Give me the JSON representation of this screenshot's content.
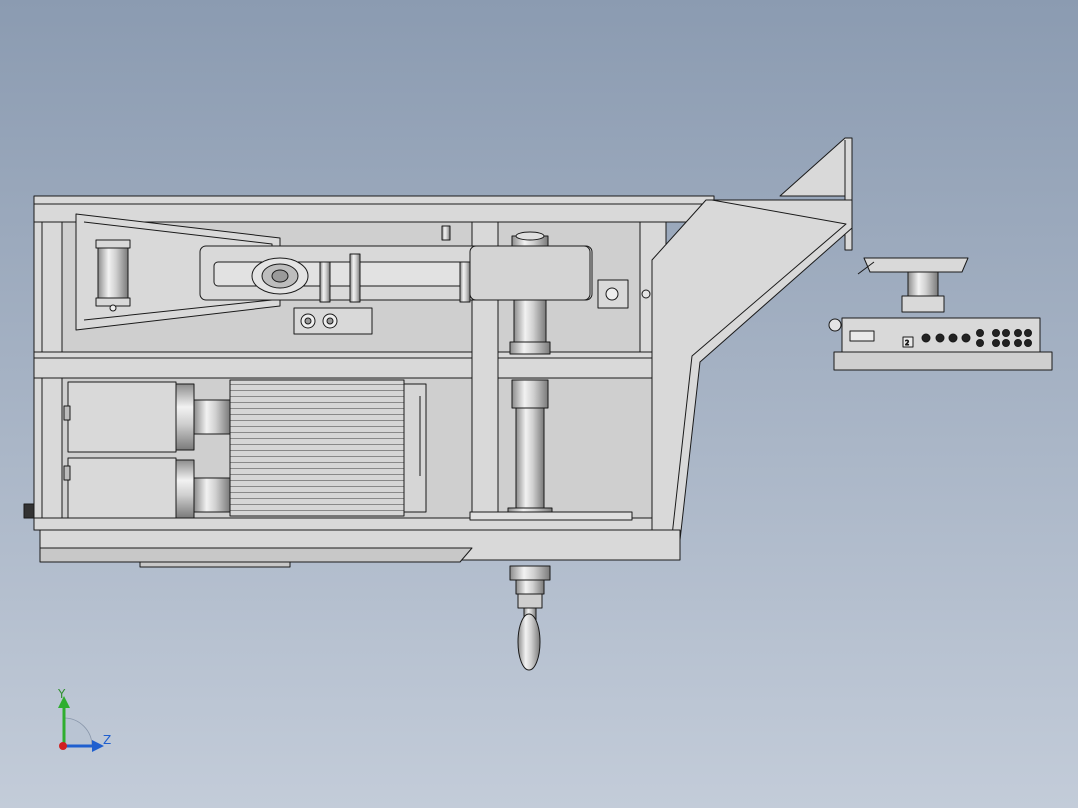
{
  "viewport": {
    "background_top": "#8b9bb1",
    "background_bottom": "#c3ccd9"
  },
  "model": {
    "part_fill": "#d9d9d9",
    "part_shade": "#bdbdbd",
    "edge_color": "#1a1a1a"
  },
  "control_panel": {
    "port_label": "2"
  },
  "triad": {
    "y_label": "Y",
    "z_label": "Z",
    "y_color": "#2fae2f",
    "z_color": "#1f5fcf",
    "x_color": "#d02020"
  }
}
